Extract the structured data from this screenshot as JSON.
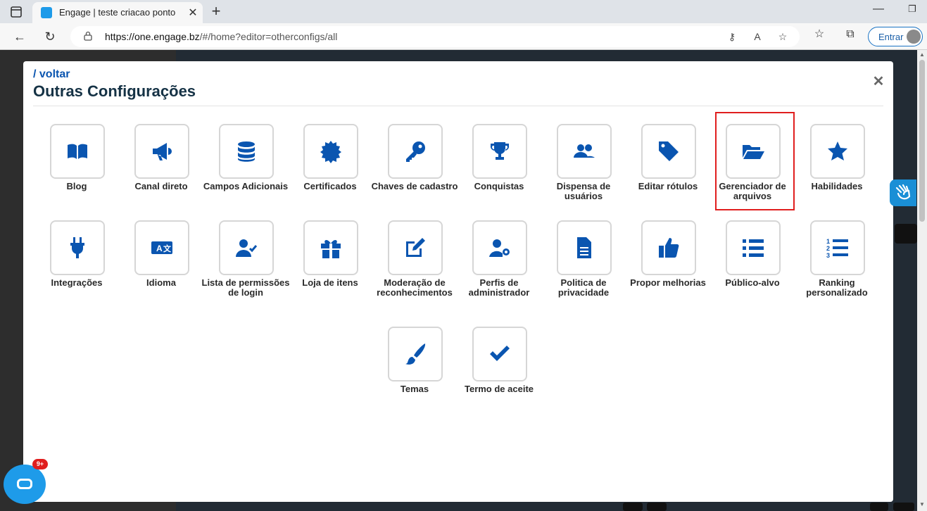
{
  "browser": {
    "tab_title": "Engage | teste criacao ponto",
    "tab_close": "✕",
    "new_tab": "+",
    "minimize": "—",
    "maximize": "❐",
    "back": "←",
    "refresh": "↻",
    "url_host": "https://one.engage.bz",
    "url_path": "/#/home?editor=otherconfigs/all",
    "signin_label": "Entrar"
  },
  "modal": {
    "back_link": "/ voltar",
    "title": "Outras Configurações",
    "close": "✕"
  },
  "tiles": [
    {
      "label": "Blog",
      "icon": "book-icon"
    },
    {
      "label": "Canal direto",
      "icon": "megaphone-icon"
    },
    {
      "label": "Campos Adicionais",
      "icon": "database-icon"
    },
    {
      "label": "Certificados",
      "icon": "certificate-icon"
    },
    {
      "label": "Chaves de cadastro",
      "icon": "key-icon"
    },
    {
      "label": "Conquistas",
      "icon": "trophy-icon"
    },
    {
      "label": "Dispensa de usuários",
      "icon": "users-icon"
    },
    {
      "label": "Editar rótulos",
      "icon": "tag-icon"
    },
    {
      "label": "Gerenciador de arquivos",
      "icon": "folder-open-icon"
    },
    {
      "label": "Habilidades",
      "icon": "star-icon"
    },
    {
      "label": "Integrações",
      "icon": "plug-icon"
    },
    {
      "label": "Idioma",
      "icon": "language-icon"
    },
    {
      "label": "Lista de permissões de login",
      "icon": "user-check-icon"
    },
    {
      "label": "Loja de itens",
      "icon": "gift-icon"
    },
    {
      "label": "Moderação de reconhecimentos",
      "icon": "edit-icon"
    },
    {
      "label": "Perfis de administrador",
      "icon": "user-cog-icon"
    },
    {
      "label": "Politica de privacidade",
      "icon": "document-icon"
    },
    {
      "label": "Propor melhorias",
      "icon": "thumbs-up-icon"
    },
    {
      "label": "Público-alvo",
      "icon": "list-icon"
    },
    {
      "label": "Ranking personalizado",
      "icon": "ordered-list-icon"
    },
    {
      "label": "Temas",
      "icon": "paintbrush-icon"
    },
    {
      "label": "Termo de aceite",
      "icon": "check-icon"
    }
  ],
  "chat": {
    "badge": "9+"
  },
  "colors": {
    "accent": "#0a55b0",
    "title": "#153245",
    "highlight": "#e01e1e"
  }
}
